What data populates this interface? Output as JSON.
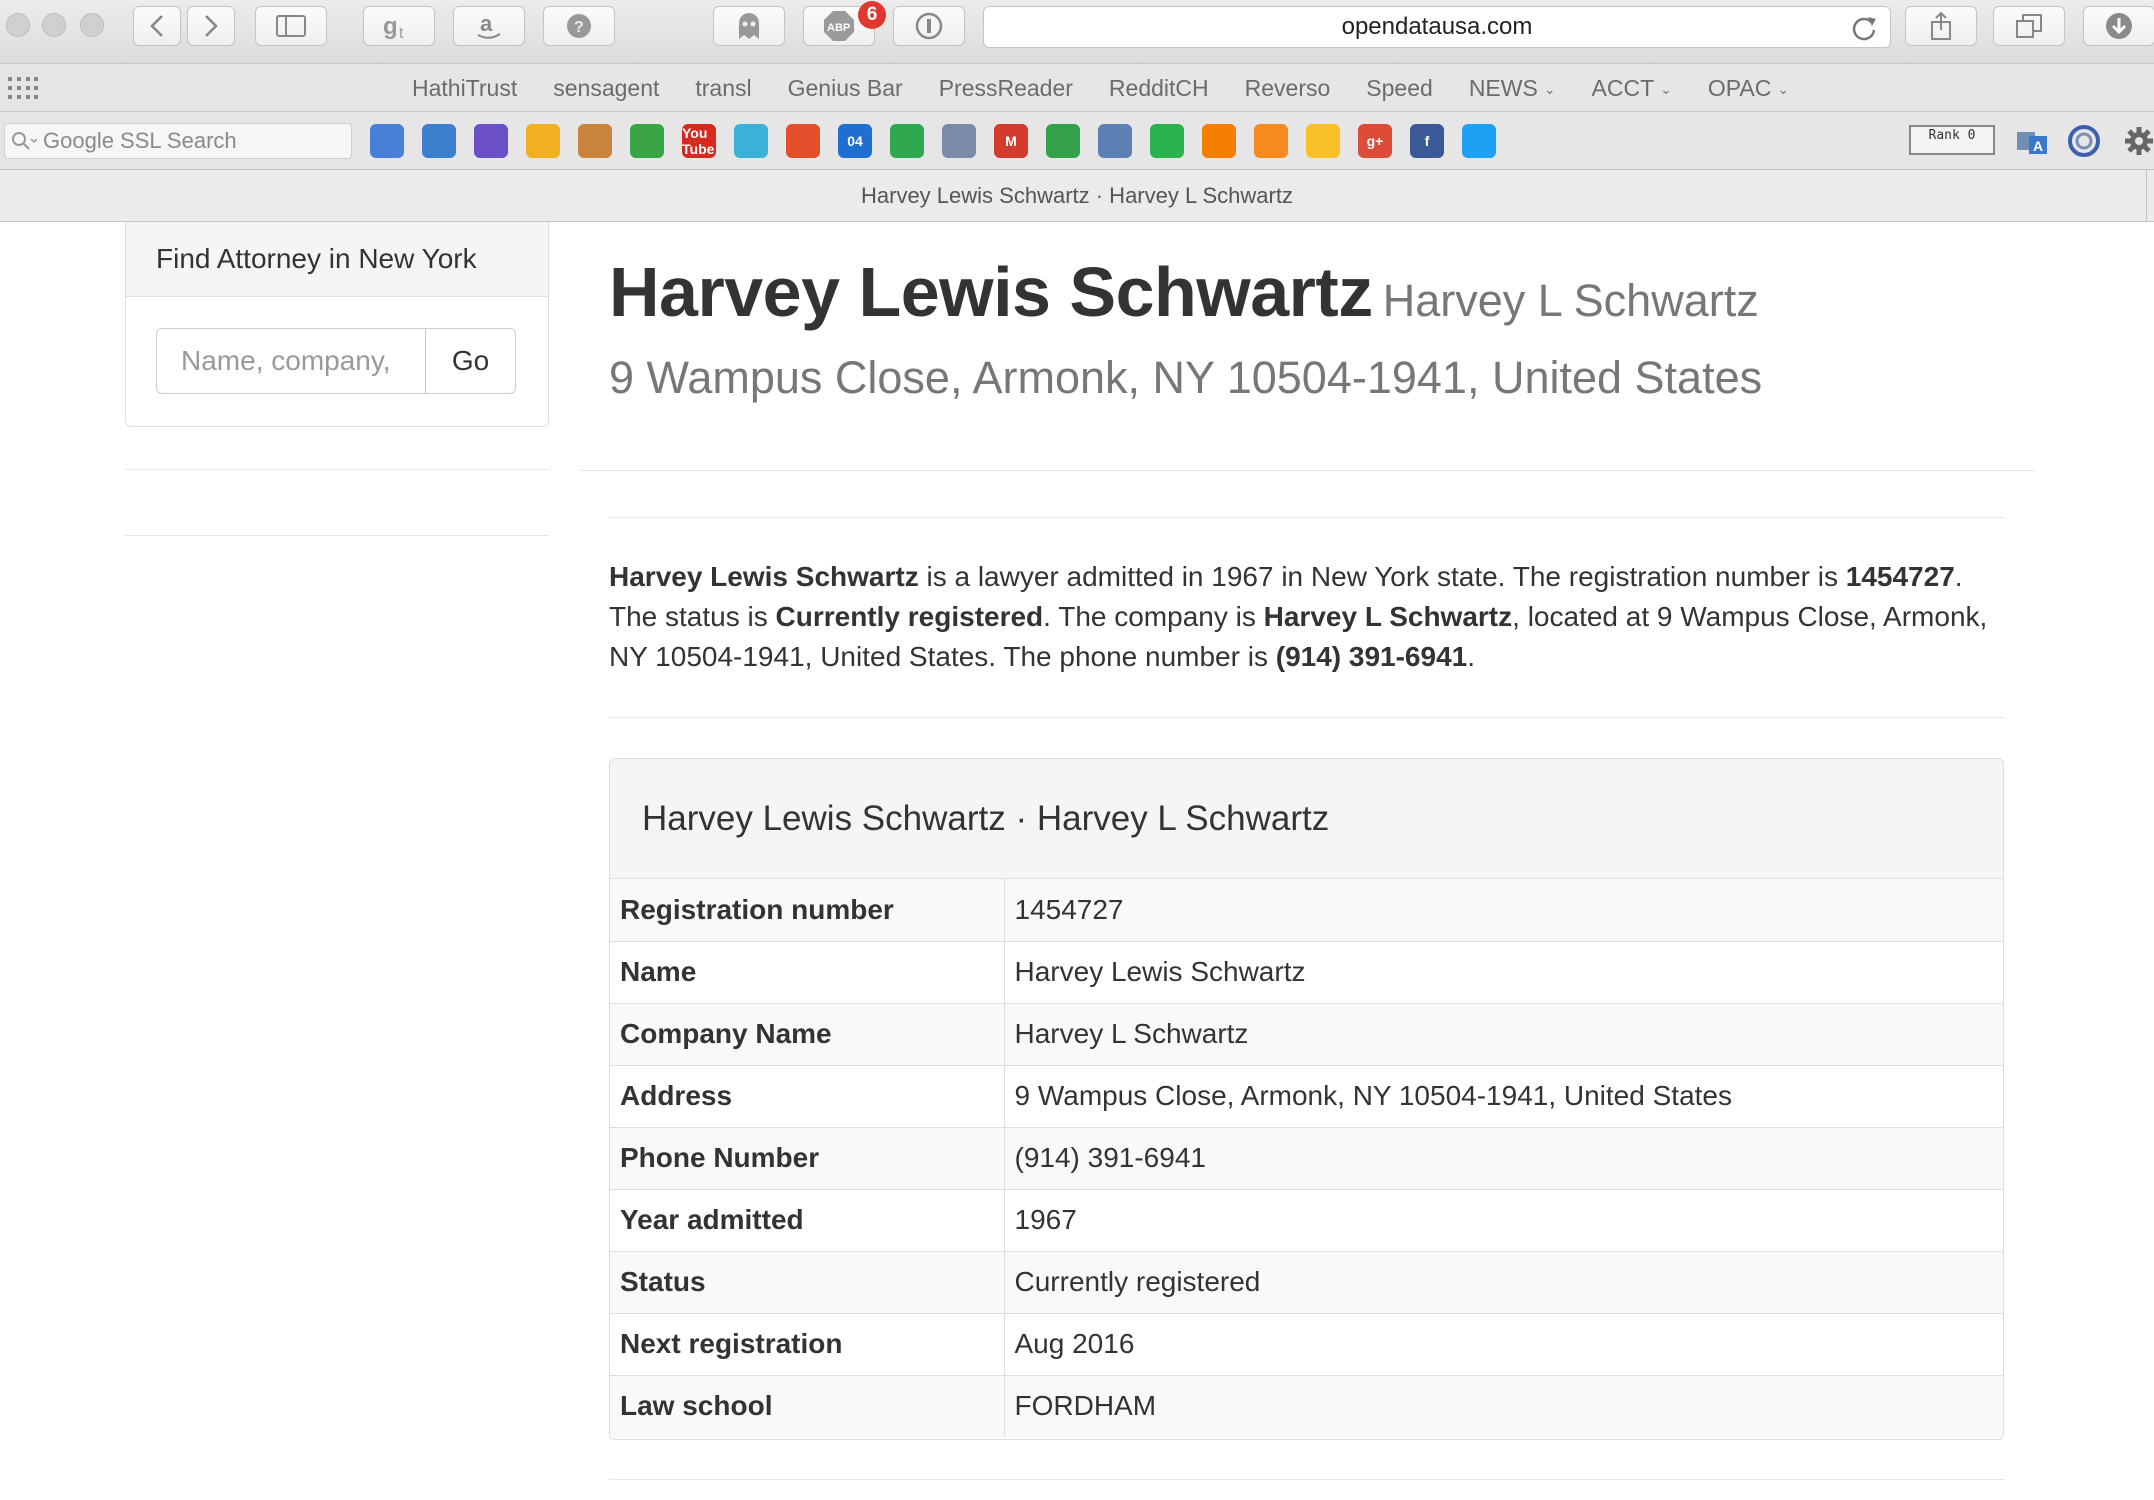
{
  "browser": {
    "url": "opendatausa.com",
    "tab_title": "Harvey Lewis Schwartz · Harvey L Schwartz",
    "abp_count": "6",
    "abp_label": "ABP",
    "rank_label": "Rank 0",
    "favorites": [
      {
        "label": "HathiTrust"
      },
      {
        "label": "sensagent"
      },
      {
        "label": "transl"
      },
      {
        "label": "Genius Bar"
      },
      {
        "label": "PressReader"
      },
      {
        "label": "RedditCH"
      },
      {
        "label": "Reverso"
      },
      {
        "label": "Speed"
      },
      {
        "label": "NEWS",
        "menu": true
      },
      {
        "label": "ACCT",
        "menu": true
      },
      {
        "label": "OPAC",
        "menu": true
      }
    ],
    "search_placeholder": "Google SSL Search",
    "extensions": [
      {
        "name": "google-toolbar-icon",
        "color": "#4a7fd8"
      },
      {
        "name": "camera-icon",
        "color": "#3d7fcf"
      },
      {
        "name": "clapper-icon",
        "color": "#6a4fc7"
      },
      {
        "name": "photos-icon",
        "color": "#f0b020"
      },
      {
        "name": "books-icon",
        "color": "#c8843a"
      },
      {
        "name": "chart-icon",
        "color": "#3aa545"
      },
      {
        "name": "youtube-icon",
        "color": "#d62a20",
        "text": "You Tube"
      },
      {
        "name": "play-store-icon",
        "color": "#3bb0d8"
      },
      {
        "name": "picasa-icon",
        "color": "#e34f2b"
      },
      {
        "name": "calendar-icon",
        "color": "#1f6fd1",
        "text": "04"
      },
      {
        "name": "drive-icon",
        "color": "#2fa84f"
      },
      {
        "name": "contacts-icon",
        "color": "#7b8aa6"
      },
      {
        "name": "gmail-icon",
        "color": "#d33b2c",
        "text": "M"
      },
      {
        "name": "tasks-icon",
        "color": "#35a04a"
      },
      {
        "name": "voice-icon",
        "color": "#5c7fb4"
      },
      {
        "name": "feedly-icon",
        "color": "#2bb24c"
      },
      {
        "name": "blogger-icon",
        "color": "#f57d00"
      },
      {
        "name": "chat-icon",
        "color": "#f58a1e"
      },
      {
        "name": "keep-icon",
        "color": "#f6c026"
      },
      {
        "name": "google-plus-icon",
        "color": "#dd4b39",
        "text": "g+"
      },
      {
        "name": "facebook-icon",
        "color": "#3b5998",
        "text": "f"
      },
      {
        "name": "twitter-icon",
        "color": "#1da1f2"
      }
    ]
  },
  "sidebar": {
    "heading": "Find Attorney in New York",
    "search_placeholder": "Name, company,",
    "go_label": "Go"
  },
  "header": {
    "name": "Harvey Lewis Schwartz",
    "alias": "Harvey L Schwartz",
    "address": "9 Wampus Close, Armonk, NY 10504-1941, United States"
  },
  "summary": {
    "name": "Harvey Lewis Schwartz",
    "t1": " is a lawyer admitted in 1967 in New York state. The registration number is ",
    "reg": "1454727",
    "t2": ". The status is ",
    "status": "Currently registered",
    "t3": ". The company is ",
    "company": "Harvey L Schwartz",
    "t4": ", located at 9 Wampus Close, Armonk, NY 10504-1941, United States. The phone number is ",
    "phone": "(914) 391-6941",
    "t5": "."
  },
  "details": {
    "heading": "Harvey Lewis Schwartz · Harvey L Schwartz",
    "rows": [
      {
        "label": "Registration number",
        "value": "1454727"
      },
      {
        "label": "Name",
        "value": "Harvey Lewis Schwartz"
      },
      {
        "label": "Company Name",
        "value": "Harvey L Schwartz"
      },
      {
        "label": "Address",
        "value": "9 Wampus Close, Armonk, NY 10504-1941, United States"
      },
      {
        "label": "Phone Number",
        "value": "(914) 391-6941"
      },
      {
        "label": "Year admitted",
        "value": "1967"
      },
      {
        "label": "Status",
        "value": "Currently registered"
      },
      {
        "label": "Next registration",
        "value": "Aug 2016"
      },
      {
        "label": "Law school",
        "value": "FORDHAM"
      }
    ]
  }
}
